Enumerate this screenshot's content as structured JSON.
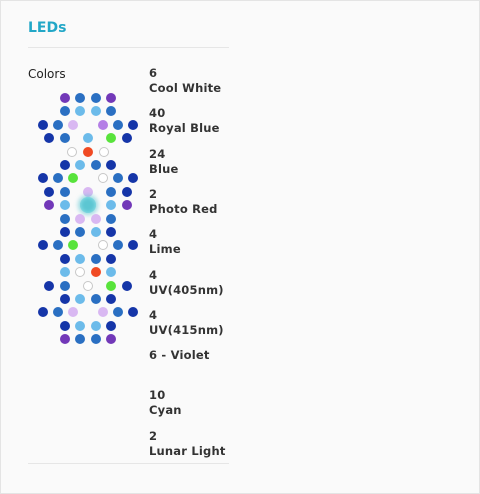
{
  "section": {
    "title": "LEDs",
    "colors_label": "Colors"
  },
  "legend": [
    {
      "count": "6",
      "name": "Cool White"
    },
    {
      "count": "40",
      "name": "Royal Blue"
    },
    {
      "count": "24",
      "name": "Blue"
    },
    {
      "count": "2",
      "name": "Photo Red"
    },
    {
      "count": "4",
      "name": "Lime"
    },
    {
      "count": "4",
      "name": "UV(405nm)"
    },
    {
      "count": "4",
      "name": "UV(415nm)"
    },
    {
      "count": "",
      "name": "6 - Violet"
    },
    {
      "count": "10",
      "name": "Cyan"
    },
    {
      "count": "2",
      "name": "Lunar Light"
    }
  ],
  "led_colors": {
    "W": "#ffffff",
    "R": "#1535a8",
    "B": "#2a6fc2",
    "C": "#6cbbea",
    "P": "#f04a23",
    "L": "#58e33b",
    "U": "#d9b8f2",
    "V": "#b47fe6",
    "I": "#7238b8",
    "M": "#5cc6d2"
  },
  "led_rows": [
    "I B B I",
    "B C C B",
    "R B U V B R",
    "R B C L R",
    "W P W",
    "R C B R",
    "R B L W B R",
    "R B U B R",
    "I C M C I",
    "B U U B",
    "R B C R",
    "R B L W B R",
    "R C B R",
    "C W P C",
    "R B W L R",
    "R C B R",
    "R B U U B R",
    "R C C R",
    "I B B I"
  ]
}
